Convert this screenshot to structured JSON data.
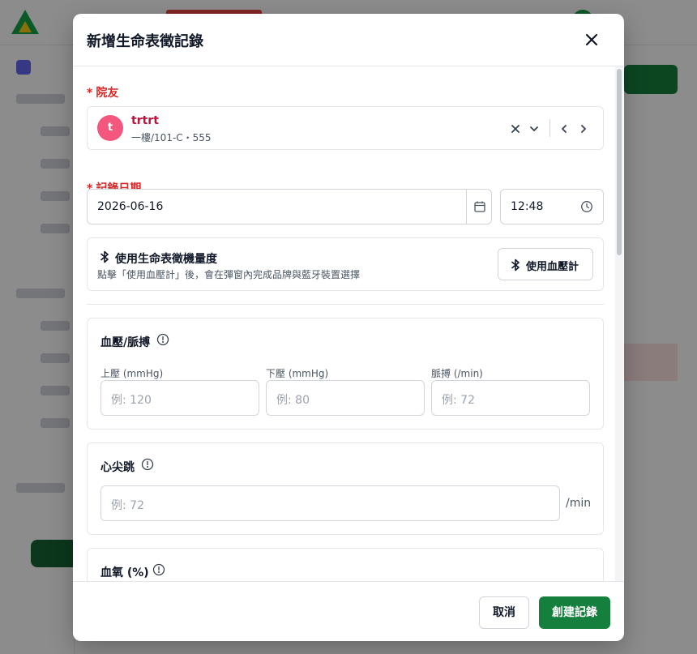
{
  "modal": {
    "title": "新增生命表徵記錄",
    "close_icon": "close-icon"
  },
  "resident": {
    "label": "院友",
    "required_mark": "*",
    "avatar_initial": "t",
    "name": "trtrt",
    "location": "一樓/101-C・555",
    "avatar_color": "#f4577e"
  },
  "record_date": {
    "label": "記錄日期",
    "required_mark": "*",
    "date_value": "2026-06-16",
    "time_value": "12:48"
  },
  "bluetooth": {
    "title": "使用生命表徵機量度",
    "description": "點擊「使用血壓計」後，會在彈窗內完成品牌與藍牙裝置選擇",
    "button_label": "使用血壓計"
  },
  "blood_pressure": {
    "title": "血壓/脈搏",
    "systolic_label": "上壓 (mmHg)",
    "systolic_placeholder": "例: 120",
    "diastolic_label": "下壓 (mmHg)",
    "diastolic_placeholder": "例: 80",
    "pulse_label": "脈搏 (/min)",
    "pulse_placeholder": "例: 72"
  },
  "heart_rate": {
    "title": "心尖跳",
    "placeholder": "例: 72",
    "unit": "/min"
  },
  "oxygen": {
    "title": "血氧 (%)"
  },
  "footer": {
    "cancel_label": "取消",
    "create_label": "創建記錄"
  },
  "colors": {
    "primary": "#15803d",
    "required": "#dc2626",
    "resident_name": "#be123c"
  }
}
